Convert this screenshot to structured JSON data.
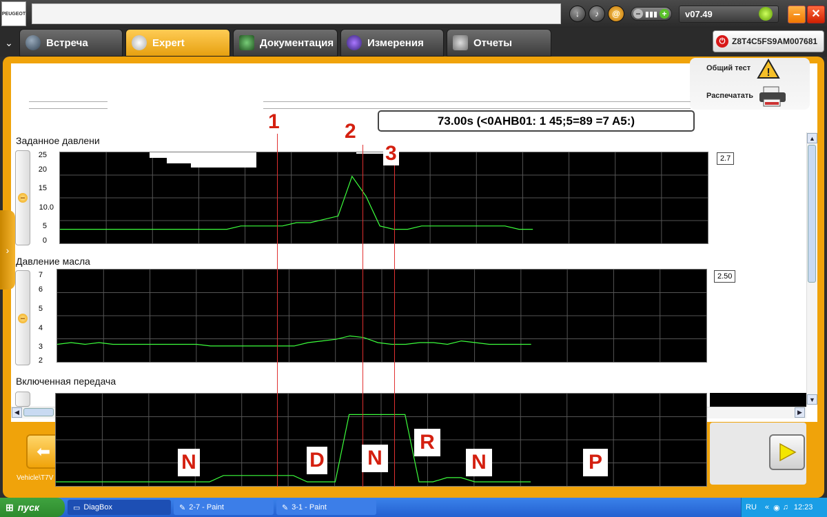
{
  "window": {
    "version": "v07.49",
    "vehicle_id": "Z8T4C5FS9AM007681"
  },
  "tabs": [
    {
      "label": "Встреча",
      "active": false
    },
    {
      "label": "Expert",
      "active": true
    },
    {
      "label": "Документация",
      "active": false
    },
    {
      "label": "Измерения",
      "active": false
    },
    {
      "label": "Отчеты",
      "active": false
    }
  ],
  "side_panel": {
    "overall_test_label": "Общий тест",
    "print_label": "Распечатать"
  },
  "time_label": "73.00s (<0AHB01: 1 45;5=89 =7 A5:)",
  "charts": [
    {
      "title": "Заданное давлени",
      "value": "2.7",
      "y_ticks": [
        "25",
        "20",
        "15",
        "10.0",
        "5",
        "0"
      ]
    },
    {
      "title": "Давление масла",
      "value": "2.50",
      "y_ticks": [
        "7",
        "6",
        "5",
        "4",
        "3",
        "2"
      ]
    },
    {
      "title": "Включенная передача",
      "value": "",
      "y_ticks": []
    }
  ],
  "markers": [
    "1",
    "2",
    "3"
  ],
  "gear_labels": [
    "N",
    "D",
    "N",
    "R",
    "N",
    "P"
  ],
  "bottom": {
    "vehicle_label": "Vehicle\\T7V"
  },
  "taskbar": {
    "start_label": "пуск",
    "tasks": [
      "DiagBox",
      "2-7 - Paint",
      "3-1 - Paint"
    ],
    "language": "RU",
    "clock": "12:23"
  },
  "colors": {
    "accent": "#f0a30a",
    "trace": "#3cff3c",
    "annotation": "#d42010"
  },
  "chart_data": [
    {
      "type": "line",
      "title": "Заданное давлени",
      "ylim": [
        0,
        25
      ],
      "series": [
        {
          "values": [
            3,
            3,
            3,
            3,
            3,
            3,
            3,
            3,
            3,
            3,
            3,
            3,
            3,
            4,
            4,
            4,
            4,
            5,
            5,
            6,
            7,
            19,
            13,
            4,
            3,
            3,
            4,
            4,
            4,
            4,
            4,
            4,
            4,
            3,
            3
          ]
        }
      ]
    },
    {
      "type": "line",
      "title": "Давление масла",
      "ylim": [
        2,
        7
      ],
      "series": [
        {
          "values": [
            2.8,
            2.9,
            2.8,
            2.9,
            2.8,
            2.8,
            2.8,
            2.8,
            2.8,
            2.8,
            2.8,
            2.7,
            2.7,
            2.7,
            2.7,
            2.7,
            2.7,
            2.7,
            2.9,
            3.0,
            3.1,
            3.3,
            3.2,
            2.9,
            2.8,
            2.8,
            2.9,
            2.9,
            2.8,
            3.0,
            2.9,
            2.8,
            2.8,
            2.8,
            2.8
          ]
        }
      ]
    },
    {
      "type": "line",
      "title": "Включенная передача",
      "ylim": [
        0,
        4
      ],
      "series": [
        {
          "values": [
            0,
            0,
            0,
            0,
            0,
            0,
            0,
            0,
            0,
            0,
            0,
            0,
            0.3,
            0.3,
            0.3,
            0.3,
            0.3,
            0.3,
            0,
            0,
            0,
            3.2,
            3.2,
            3.2,
            3.2,
            3.2,
            0,
            0,
            0.2,
            0.2,
            0,
            0,
            0,
            0,
            0
          ]
        }
      ]
    }
  ]
}
